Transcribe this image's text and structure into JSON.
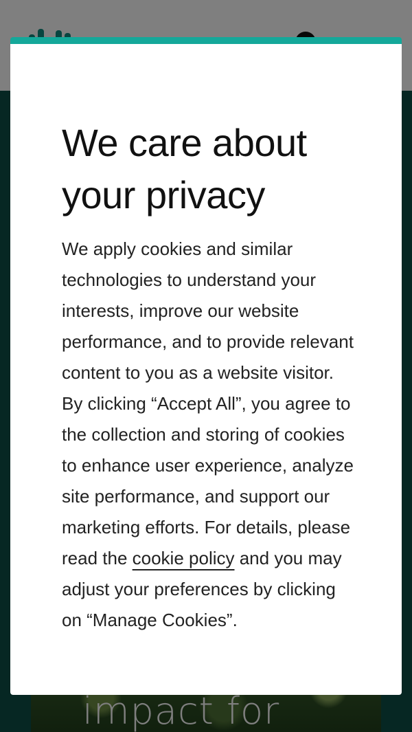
{
  "background_page": {
    "hero_text": "impact for"
  },
  "cookie_modal": {
    "title": "We care about your privacy",
    "body_before_link": "We apply cookies and similar technologies to understand your interests, improve our website performance, and to provide relevant content to you as a website visitor. By clicking “Accept All”, you agree to the collection and storing of cookies to enhance user experience, analyze site performance, and support our marketing efforts. For details, please read the ",
    "policy_link_label": "cookie policy",
    "body_after_link": " and you may adjust your preferences by clicking on “Manage Cookies”."
  },
  "colors": {
    "modal_accent": "#14a89a",
    "page_background": "#0d4f47",
    "overlay": "rgba(0,0,0,0.5)"
  },
  "icons": {
    "logo": "brand-logo",
    "account": "account-icon"
  }
}
